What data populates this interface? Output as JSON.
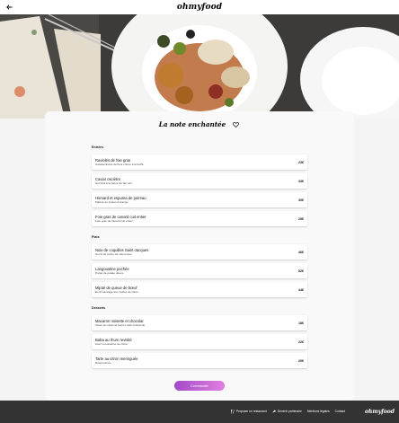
{
  "header": {
    "logo": "ohmyfood",
    "back_icon": "arrow-left-icon"
  },
  "restaurant": {
    "name": "La note enchantée",
    "favorite_icon": "heart-outline-icon"
  },
  "sections": [
    {
      "title": "Entrées",
      "items": [
        {
          "name": "Raviolés de foie gras",
          "desc": "Assaisonnées de fleur crème à la truffe",
          "price": "23€"
        },
        {
          "name": "Caviar osciètre",
          "desc": "Sur blini à la farine de blé noir",
          "price": "33€"
        },
        {
          "name": "Homard et espuma de poireau",
          "desc": "Mariné au zestes d'orange",
          "price": "30€"
        },
        {
          "name": "Foie gras de canard cuit entier",
          "desc": "Foie gras de canard cuit entier",
          "price": "25€"
        }
      ]
    },
    {
      "title": "Plats",
      "items": [
        {
          "name": "Noix de coquilles Saint-Jacques",
          "desc": "Sur lit de purée de céleri-rave",
          "price": "46€"
        },
        {
          "name": "Langoustine pochée",
          "desc": "Purée de patate douce",
          "price": "52€"
        },
        {
          "name": "Mijoté de queue de bœuf",
          "desc": "Et riz sauvage aux zestes de citron",
          "price": "44€"
        }
      ]
    },
    {
      "title": "Desserts",
      "items": [
        {
          "name": "Macaron noisette et chocolat",
          "desc": "Glace au caramel beurre salé Guérande",
          "price": "18€"
        },
        {
          "name": "Baba au rhum revisité",
          "desc": "Avec mousseline de citron",
          "price": "22€"
        },
        {
          "name": "Tarte au citron meringuée",
          "desc": "Déstructurée",
          "price": "20€"
        }
      ]
    }
  ],
  "order_button": "Commander",
  "footer": {
    "links": [
      {
        "label": "Proposer un restaurant",
        "icon": "utensils-icon"
      },
      {
        "label": "Devenir partenaire",
        "icon": "arrow-icon"
      },
      {
        "label": "Mentions légales",
        "icon": ""
      },
      {
        "label": "Contact",
        "icon": ""
      }
    ],
    "logo": "ohmyfood"
  },
  "colors": {
    "accent_start": "#a24ac9",
    "accent_end": "#e27fe0",
    "footer_bg": "#333333",
    "page_bg": "#f4f4f4"
  }
}
